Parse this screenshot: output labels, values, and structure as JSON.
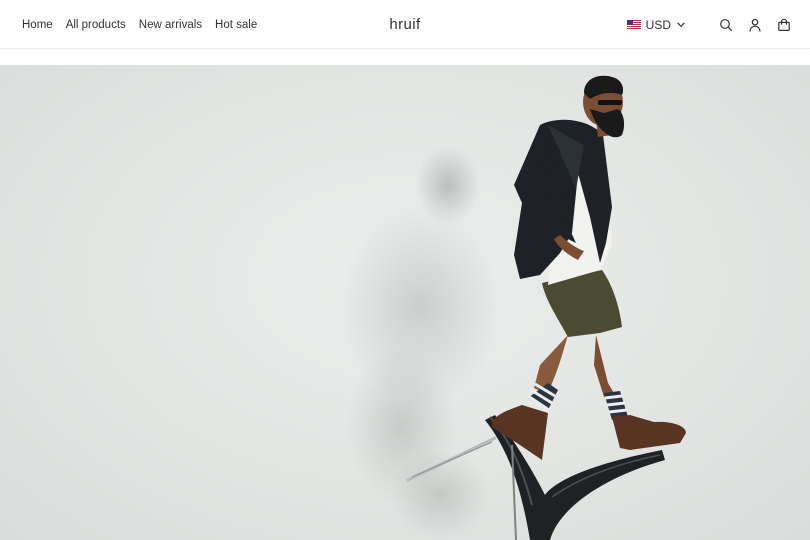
{
  "header": {
    "nav": [
      {
        "label": "Home"
      },
      {
        "label": "All products"
      },
      {
        "label": "New arrivals"
      },
      {
        "label": "Hot sale"
      }
    ],
    "brand": "hruif",
    "currency": {
      "code": "USD",
      "flag": "us-flag-icon"
    },
    "icons": [
      "search-icon",
      "account-icon",
      "cart-icon"
    ]
  },
  "hero": {
    "image": "man-standing-on-tilted-chair"
  },
  "colors": {
    "text": "#333333",
    "header_bg": "#ffffff",
    "hero_bg": "#e3e5e3"
  }
}
